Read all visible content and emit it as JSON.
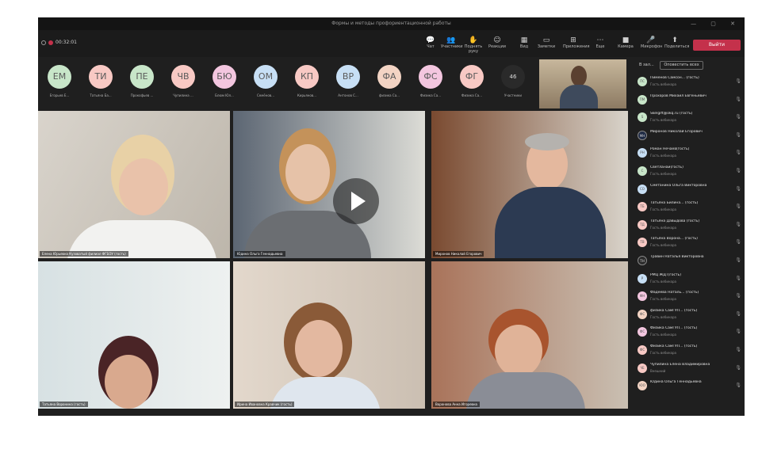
{
  "window": {
    "title": "Формы и методы профориентационной работы",
    "timer": "00:32:01"
  },
  "toolbar": {
    "buttons": [
      {
        "label": "Чат",
        "icon": "chat-icon",
        "glyph": "💬"
      },
      {
        "label": "Участники",
        "icon": "people-icon",
        "glyph": "👥"
      },
      {
        "label": "Поднять руку",
        "icon": "raise-hand-icon",
        "glyph": "✋"
      },
      {
        "label": "Реакции",
        "icon": "reactions-icon",
        "glyph": "☺"
      },
      {
        "label": "Вид",
        "icon": "view-icon",
        "glyph": "▦"
      },
      {
        "label": "Заметки",
        "icon": "notes-icon",
        "glyph": "▭"
      },
      {
        "label": "Приложения",
        "icon": "apps-icon",
        "glyph": "⊞"
      },
      {
        "label": "Еще",
        "icon": "more-icon",
        "glyph": "⋯"
      },
      {
        "label": "Камера",
        "icon": "camera-icon",
        "glyph": "■"
      },
      {
        "label": "Микрофон",
        "icon": "microphone-icon",
        "glyph": "🎤"
      },
      {
        "label": "Поделиться",
        "icon": "share-icon",
        "glyph": "⬆"
      }
    ],
    "leave_label": "Выйти"
  },
  "avatars": [
    {
      "initials": "ЕМ",
      "name": "Егорьев Е...",
      "color": "#c8e6c9"
    },
    {
      "initials": "ТИ",
      "name": "Татьяна Ба...",
      "color": "#f8c9c4"
    },
    {
      "initials": "ПЕ",
      "name": "Прокофьев ...",
      "color": "#c8e6c9"
    },
    {
      "initials": "ЧВ",
      "name": "Чупилина ...",
      "color": "#f8c9c4"
    },
    {
      "initials": "БЮ",
      "name": "Блюм Юл...",
      "color": "#f3c6df"
    },
    {
      "initials": "ОМ",
      "name": "Семёнов...",
      "color": "#c7dff5"
    },
    {
      "initials": "КП",
      "name": "Кирьянов...",
      "color": "#f8c9c4"
    },
    {
      "initials": "ВР",
      "name": "Антонов С...",
      "color": "#c7dff5"
    },
    {
      "initials": "ФА",
      "name": "физика Са...",
      "color": "#f3d4c4"
    },
    {
      "initials": "ФС",
      "name": "Физика Са...",
      "color": "#f3c6df"
    },
    {
      "initials": "ФГ",
      "name": "Физика Са...",
      "color": "#f8c9c4"
    },
    {
      "initials": "46",
      "name": "Участники",
      "color": "#2a2a2a"
    }
  ],
  "tiles": [
    {
      "name": "Елена Юрьевна Кузоватый филиал ФГБОУ (гость)"
    },
    {
      "name": "Юдина Ольга Геннадьевна"
    },
    {
      "name": "Миронов Николай Егорович"
    },
    {
      "name": "Татьяна Воронина (гость)"
    },
    {
      "name": "Ирина Ивановна Кравчик (гость)"
    },
    {
      "name": "Воронова Анна Игоревна"
    }
  ],
  "panel": {
    "search_label": "В зал...",
    "button_label": "Оповестить всех",
    "participants": [
      {
        "name": "Пименов Самсон... (гость)",
        "status": "Гость вебинара",
        "initials": "ПС",
        "color": "#c8e6c9"
      },
      {
        "name": "Прохоров Михаил Евгеньевич",
        "status": "",
        "initials": "ПМ",
        "color": "#c8e6c9"
      },
      {
        "name": "Skelgift@okq.ru (гость)",
        "status": "Гость вебинара",
        "initials": "S",
        "color": "#c8e6c9"
      },
      {
        "name": "Миронов Николай Егорович",
        "status": "",
        "initials": "МН",
        "color": "#1e2a44"
      },
      {
        "name": "Роман Нечаев(гость)",
        "status": "Гость вебинара",
        "initials": "РН",
        "color": "#c7dff5"
      },
      {
        "name": "Светланаи(гость)",
        "status": "Гость вебинара",
        "initials": "С",
        "color": "#c8e6c9"
      },
      {
        "name": "Сметанина Ольга Викторовна",
        "status": "",
        "initials": "СО",
        "color": "#c7dff5"
      },
      {
        "name": "Татьяна Билина... (гость)",
        "status": "Гость вебинара",
        "initials": "ТБ",
        "color": "#f8c9c4"
      },
      {
        "name": "Татьяна Давыдова (гость)",
        "status": "Гость вебинара",
        "initials": "ТД",
        "color": "#f8c9c4"
      },
      {
        "name": "Татьяна Ворона... (гость)",
        "status": "Гость вебинара",
        "initials": "ТВ",
        "color": "#f8c9c4"
      },
      {
        "name": "Травин Наталья Викторовна",
        "status": "",
        "initials": "ТН",
        "color": "#2a2a2a"
      },
      {
        "name": "РМЦ ЖДТ(гость)",
        "status": "Гость вебинара",
        "initials": "Р",
        "color": "#c7dff5"
      },
      {
        "name": "Фадеева Наталь... (гость)",
        "status": "Гость вебинара",
        "initials": "ФН",
        "color": "#f3c6df"
      },
      {
        "name": "физика СамГУП... (гость)",
        "status": "Гость вебинара",
        "initials": "ФС",
        "color": "#f3d4c4"
      },
      {
        "name": "Физика СамГУП... (гость)",
        "status": "Гость вебинара",
        "initials": "ФС",
        "color": "#f3c6df"
      },
      {
        "name": "Физика СамГУП... (гость)",
        "status": "Гость вебинара",
        "initials": "ФС",
        "color": "#f8c9c4"
      },
      {
        "name": "Чупилина Елена Владимировна",
        "status": "Внешний",
        "initials": "ЧЕ",
        "color": "#f8c9c4"
      },
      {
        "name": "Юдина Ольга Геннадьевна",
        "status": "",
        "initials": "ЮО",
        "color": "#f3d4c4"
      }
    ]
  }
}
